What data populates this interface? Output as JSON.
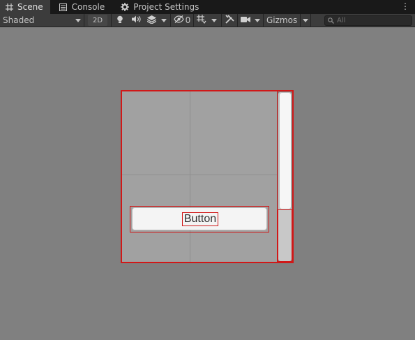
{
  "tabs": [
    {
      "label": "Scene",
      "icon": "grid-icon",
      "active": true
    },
    {
      "label": "Console",
      "icon": "console-icon",
      "active": false
    },
    {
      "label": "Project Settings",
      "icon": "gear-icon",
      "active": false
    }
  ],
  "toolbar": {
    "draw_mode": "Shaded",
    "mode_2d": "2D",
    "hidden_count": "0",
    "gizmos": "Gizmos",
    "search_placeholder": "All"
  },
  "scene": {
    "button_label": "Button"
  },
  "colors": {
    "background": "#808080",
    "selection_outline": "#d01818",
    "toolbar": "#3c3c3c",
    "tabbar": "#191919"
  }
}
